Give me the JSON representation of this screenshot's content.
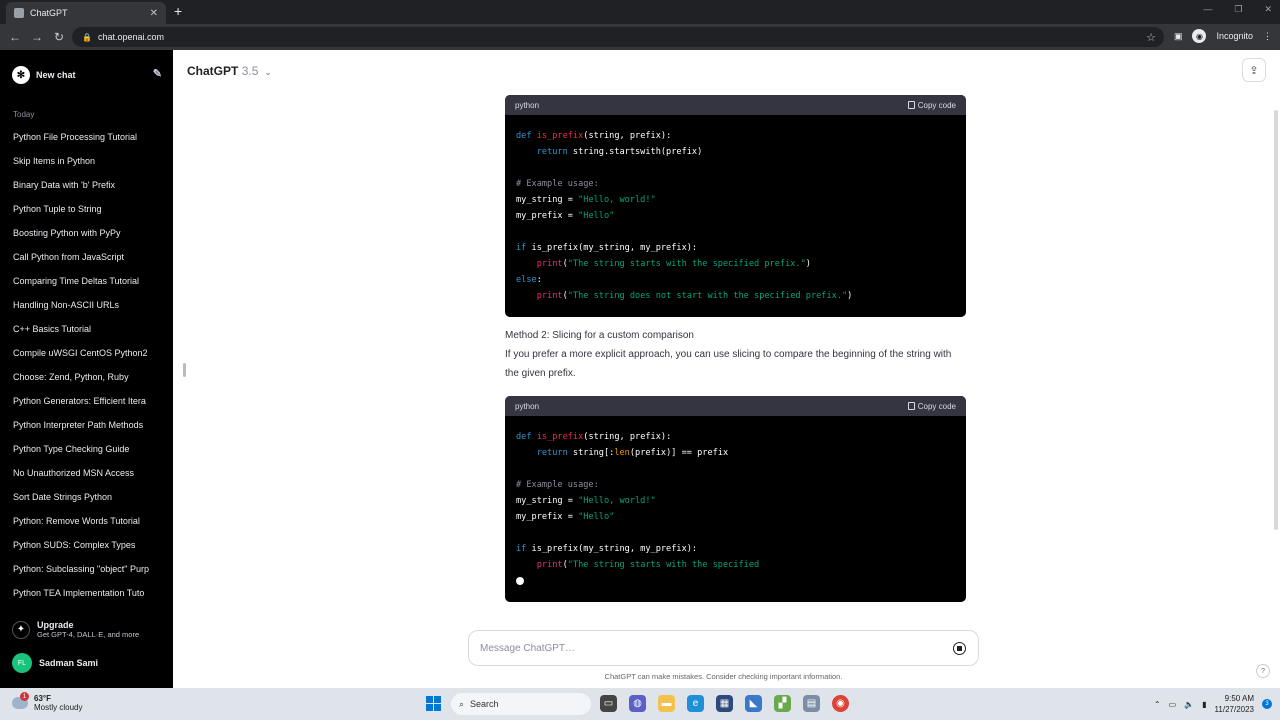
{
  "browser": {
    "tab_title": "ChatGPT",
    "new_tab": "+",
    "url": "chat.openai.com",
    "profile": "Incognito"
  },
  "sidebar": {
    "new_chat": "New chat",
    "section": "Today",
    "items": [
      "Python File Processing Tutorial",
      "Skip Items in Python",
      "Binary Data with 'b' Prefix",
      "Python Tuple to String",
      "Boosting Python with PyPy",
      "Call Python from JavaScript",
      "Comparing Time Deltas Tutorial",
      "Handling Non-ASCII URLs",
      "C++ Basics Tutorial",
      "Compile uWSGI CentOS Python2",
      "Choose: Zend, Python, Ruby",
      "Python Generators: Efficient Itera",
      "Python Interpreter Path Methods",
      "Python Type Checking Guide",
      "No Unauthorized MSN Access",
      "Sort Date Strings Python",
      "Python: Remove Words Tutorial",
      "Python SUDS: Complex Types",
      "Python: Subclassing \"object\" Purp",
      "Python TEA Implementation Tuto"
    ],
    "upgrade_title": "Upgrade",
    "upgrade_sub": "Get GPT-4, DALL·E, and more",
    "user_initials": "FL",
    "user_name": "Sadman Sami"
  },
  "main": {
    "model_name": "ChatGPT",
    "model_version": "3.5",
    "code1": {
      "lang": "python",
      "copy_label": "Copy code"
    },
    "method2_title": "Method 2: Slicing for a custom comparison",
    "method2_body": "If you prefer a more explicit approach, you can use slicing to compare the beginning of the string with the given prefix.",
    "code2": {
      "lang": "python",
      "copy_label": "Copy code"
    },
    "composer_placeholder": "Message ChatGPT…",
    "disclaimer": "ChatGPT can make mistakes. Consider checking important information.",
    "help": "?"
  },
  "taskbar": {
    "temperature": "63°F",
    "weather": "Mostly cloudy",
    "weather_badge": "1",
    "search": "Search",
    "time": "9:50 AM",
    "date": "11/27/2023",
    "notif_count": "3"
  },
  "colors": {
    "sidebar_bg": "#000000",
    "code_bg": "#000000",
    "code_header_bg": "#343541",
    "keyword": "#2e95d3",
    "function": "#f22c3d",
    "string": "#00a67d",
    "comment": "#8e8ea0"
  }
}
